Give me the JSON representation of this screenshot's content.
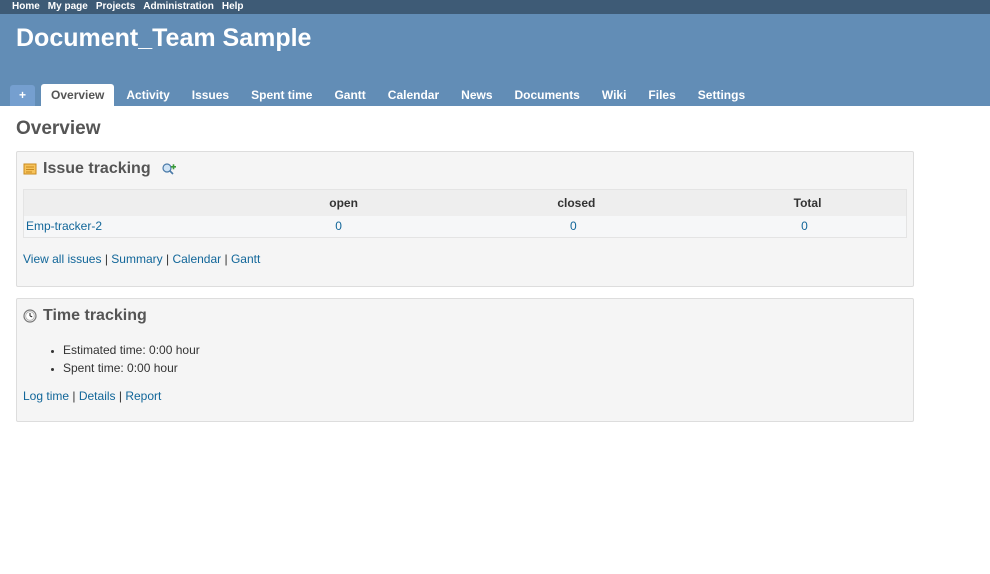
{
  "top_menu": [
    "Home",
    "My page",
    "Projects",
    "Administration",
    "Help"
  ],
  "header": {
    "project_title": "Document_Team Sample"
  },
  "main_menu": {
    "new_label": "+",
    "tabs": [
      "Overview",
      "Activity",
      "Issues",
      "Spent time",
      "Gantt",
      "Calendar",
      "News",
      "Documents",
      "Wiki",
      "Files",
      "Settings"
    ],
    "selected": "Overview"
  },
  "page": {
    "heading": "Overview"
  },
  "issue_tracking": {
    "title": "Issue tracking",
    "columns": [
      "",
      "open",
      "closed",
      "Total"
    ],
    "rows": [
      {
        "name": "Emp-tracker-2",
        "open": "0",
        "closed": "0",
        "total": "0"
      }
    ],
    "links": [
      "View all issues",
      "Summary",
      "Calendar",
      "Gantt"
    ],
    "separator": "|"
  },
  "time_tracking": {
    "title": "Time tracking",
    "items": [
      "Estimated time: 0:00 hour",
      "Spent time: 0:00 hour"
    ],
    "links": [
      "Log time",
      "Details",
      "Report"
    ],
    "separator": "|"
  },
  "colors": {
    "top_menu_bg": "#3e5b76",
    "header_bg": "#628db6",
    "link": "#116699",
    "box_bg": "#f5f5f5"
  },
  "icons": {
    "issue_tracking": "issue-tracking-icon",
    "add_filter": "add-filter-icon",
    "time_tracking": "clock-icon"
  }
}
